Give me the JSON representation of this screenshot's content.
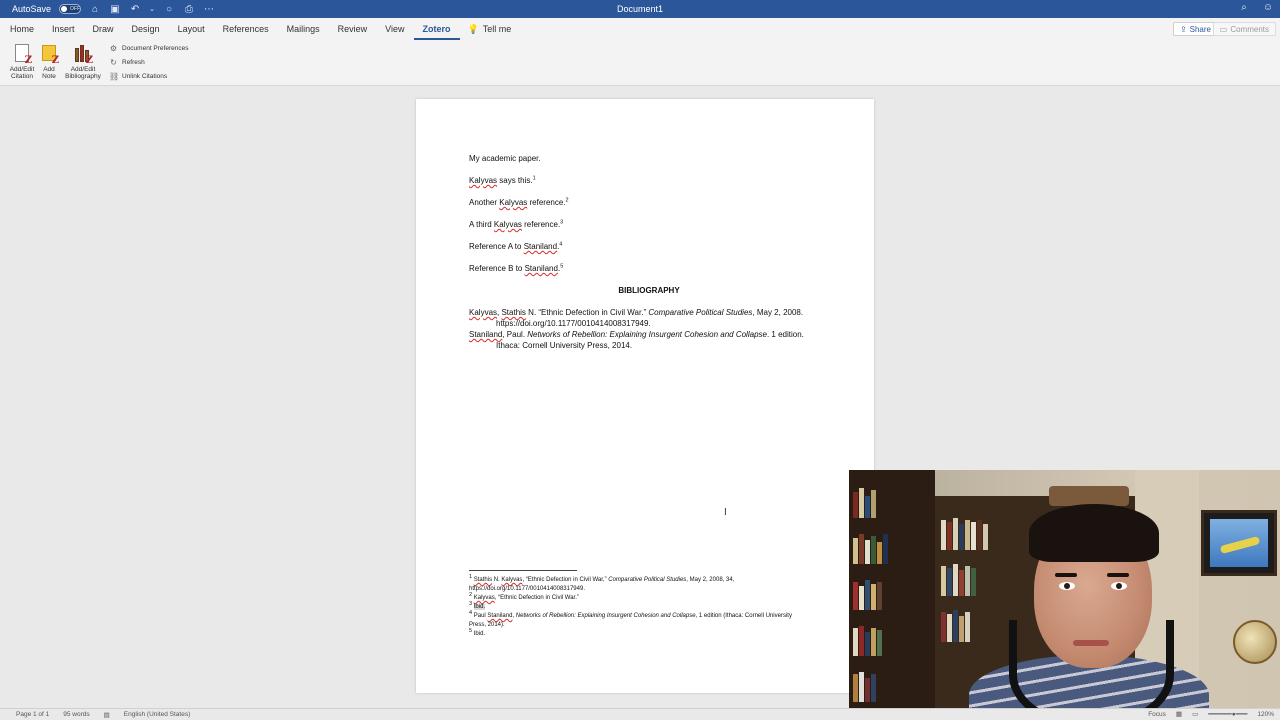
{
  "titlebar": {
    "autosave_label": "AutoSave",
    "autosave_state": "OFF",
    "document_title": "Document1"
  },
  "tabs": [
    {
      "label": "Home"
    },
    {
      "label": "Insert"
    },
    {
      "label": "Draw"
    },
    {
      "label": "Design"
    },
    {
      "label": "Layout"
    },
    {
      "label": "References"
    },
    {
      "label": "Mailings"
    },
    {
      "label": "Review"
    },
    {
      "label": "View"
    },
    {
      "label": "Zotero",
      "active": true
    }
  ],
  "tell_me": "Tell me",
  "share_label": "Share",
  "comments_label": "Comments",
  "ribbon": {
    "add_edit_citation": [
      "Add/Edit",
      "Citation"
    ],
    "add_note": [
      "Add",
      "Note"
    ],
    "add_edit_bibliography": [
      "Add/Edit",
      "Bibliography"
    ],
    "document_preferences": "Document Preferences",
    "refresh": "Refresh",
    "unlink_citations": "Unlink Citations"
  },
  "document": {
    "p1": "My academic paper.",
    "p2_a": "Kalyvas",
    "p2_b": " says this.",
    "p2_n": "1",
    "p3_a": "Another ",
    "p3_b": "Kalyvas",
    "p3_c": " reference.",
    "p3_n": "2",
    "p4_a": "A third ",
    "p4_b": "Kalyvas",
    "p4_c": " reference.",
    "p4_n": "3",
    "p5_a": "Reference A to ",
    "p5_b": "Staniland",
    "p5_c": ".",
    "p5_n": "4",
    "p6_a": "Reference B to ",
    "p6_b": "Staniland",
    "p6_c": ".",
    "p6_n": "5",
    "bibliography_heading": "BIBLIOGRAPHY",
    "bib1_a": "Kalyvas",
    "bib1_b": ", ",
    "bib1_c": "Stathis",
    "bib1_d": " N. “Ethnic Defection in Civil War.” ",
    "bib1_e": "Comparative Political Studies",
    "bib1_f": ", May 2, 2008. https://doi.org/10.1177/0010414008317949.",
    "bib2_a": "Staniland",
    "bib2_b": ", Paul. ",
    "bib2_c": "Networks of Rebellion: Explaining Insurgent Cohesion and Collapse",
    "bib2_d": ". 1 edition. Ithaca: Cornell University Press, 2014."
  },
  "footnotes": {
    "f1_n": "1",
    "f1_a": "Stathis",
    "f1_b": " N. ",
    "f1_c": "Kalyvas",
    "f1_d": ", “Ethnic Defection in Civil War,” ",
    "f1_e": "Comparative Political Studies",
    "f1_f": ", May 2, 2008, 34, https://doi.org/10.1177/0010414008317949.",
    "f2_n": "2",
    "f2_a": "Kalyvas",
    "f2_b": ", “Ethnic Defection in Civil War.”",
    "f3_n": "3",
    "f3_a": "Ibid.",
    "f4_n": "4",
    "f4_a": " Paul ",
    "f4_b": "Staniland",
    "f4_c": ", ",
    "f4_d": "Networks of Rebellion: Explaining Insurgent Cohesion and Collapse",
    "f4_e": ", 1 edition (Ithaca: Cornell University Press, 2014).",
    "f5_n": "5",
    "f5_a": " Ibid."
  },
  "statusbar": {
    "page": "Page 1 of 1",
    "words": "95 words",
    "language": "English (United States)",
    "focus": "Focus",
    "zoom": "120%"
  },
  "colors": {
    "title_bar": "#2b579a",
    "active_tab": "#2b579a",
    "spell_squiggle": "#d42b2b"
  }
}
